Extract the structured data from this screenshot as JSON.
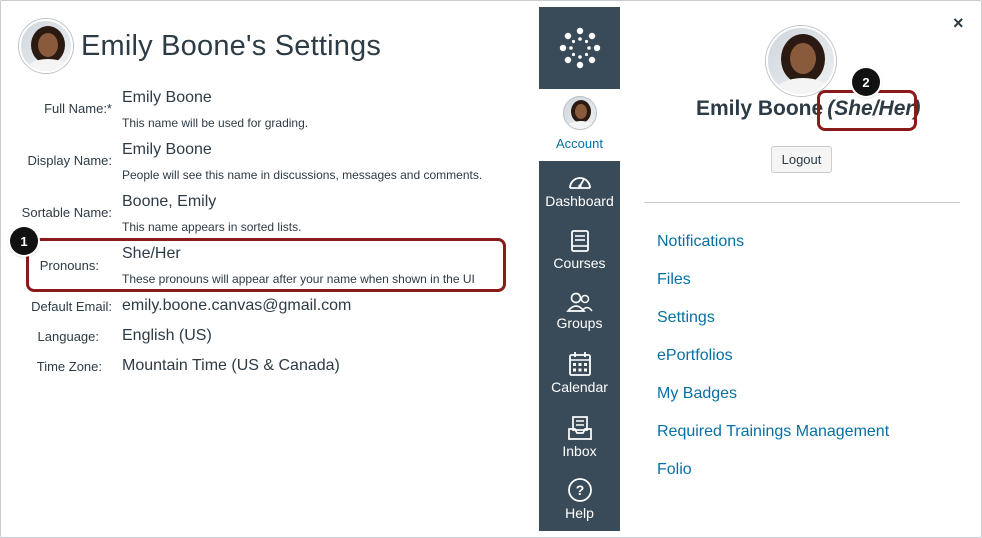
{
  "settings": {
    "title": "Emily Boone's Settings",
    "fields": [
      {
        "label": "Full Name:*",
        "value": "Emily Boone",
        "hint": "This name will be used for grading."
      },
      {
        "label": "Display Name:",
        "value": "Emily Boone",
        "hint": "People will see this name in discussions, messages and comments."
      },
      {
        "label": "Sortable Name:",
        "value": "Boone, Emily",
        "hint": "This name appears in sorted lists."
      },
      {
        "label": "Pronouns:",
        "value": "She/Her",
        "hint": "These pronouns will appear after your name when shown in the UI"
      },
      {
        "label": "Default Email:",
        "value": "emily.boone.canvas@gmail.com"
      },
      {
        "label": "Language:",
        "value": "English (US)"
      },
      {
        "label": "Time Zone:",
        "value": "Mountain Time (US & Canada)"
      }
    ]
  },
  "callouts": {
    "one": "1",
    "two": "2"
  },
  "nav": {
    "account": "Account",
    "items": [
      {
        "label": "Dashboard",
        "icon": "dashboard-icon"
      },
      {
        "label": "Courses",
        "icon": "courses-icon"
      },
      {
        "label": "Groups",
        "icon": "groups-icon"
      },
      {
        "label": "Calendar",
        "icon": "calendar-icon"
      },
      {
        "label": "Inbox",
        "icon": "inbox-icon"
      },
      {
        "label": "Help",
        "icon": "help-icon"
      }
    ]
  },
  "tray": {
    "close": "×",
    "name": "Emily Boone",
    "pronouns": "(She/Her)",
    "logout": "Logout",
    "links": [
      "Notifications",
      "Files",
      "Settings",
      "ePortfolios",
      "My Badges",
      "Required Trainings Management",
      "Folio"
    ]
  },
  "colors": {
    "nav_bg": "#394b58",
    "link": "#0770a3",
    "highlight": "#8b1a1a"
  }
}
